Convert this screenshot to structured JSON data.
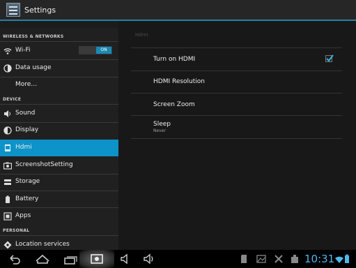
{
  "app": {
    "title": "Settings",
    "icon": "settings-icon"
  },
  "sidebar": {
    "sections": [
      {
        "label": "WIRELESS & NETWORKS"
      },
      {
        "label": "DEVICE"
      },
      {
        "label": "PERSONAL"
      }
    ],
    "items": [
      {
        "label": "Wi-Fi",
        "icon": "wifi-icon",
        "toggle": "ON"
      },
      {
        "label": "Data usage",
        "icon": "data-usage-icon"
      },
      {
        "label": "More…",
        "icon": ""
      },
      {
        "label": "Sound",
        "icon": "speaker-icon"
      },
      {
        "label": "Display",
        "icon": "display-icon"
      },
      {
        "label": "Hdmi",
        "icon": "hdmi-icon",
        "selected": true
      },
      {
        "label": "ScreenshotSetting",
        "icon": "camera-icon"
      },
      {
        "label": "Storage",
        "icon": "storage-icon"
      },
      {
        "label": "Battery",
        "icon": "battery-icon"
      },
      {
        "label": "Apps",
        "icon": "apps-icon"
      },
      {
        "label": "Location services",
        "icon": "location-icon"
      }
    ]
  },
  "detail": {
    "header": "Hdmi",
    "items": [
      {
        "label": "Turn on HDMI",
        "checked": true
      },
      {
        "label": "HDMI Resolution"
      },
      {
        "label": "Screen Zoom"
      },
      {
        "label": "Sleep",
        "summary": "Never"
      }
    ]
  },
  "navbar": {
    "buttons": [
      "back-icon",
      "home-icon",
      "recent-apps-icon",
      "screenshot-icon",
      "volume-down-icon",
      "volume-up-icon"
    ],
    "status_icons": [
      "sd-card-icon",
      "gallery-icon",
      "usb-icon",
      "download-icon",
      "clipboard-icon"
    ],
    "time": "10:31"
  },
  "colors": {
    "accent": "#0d93c9",
    "clock": "#4fb8e8",
    "divider": "#2c7fa5"
  }
}
